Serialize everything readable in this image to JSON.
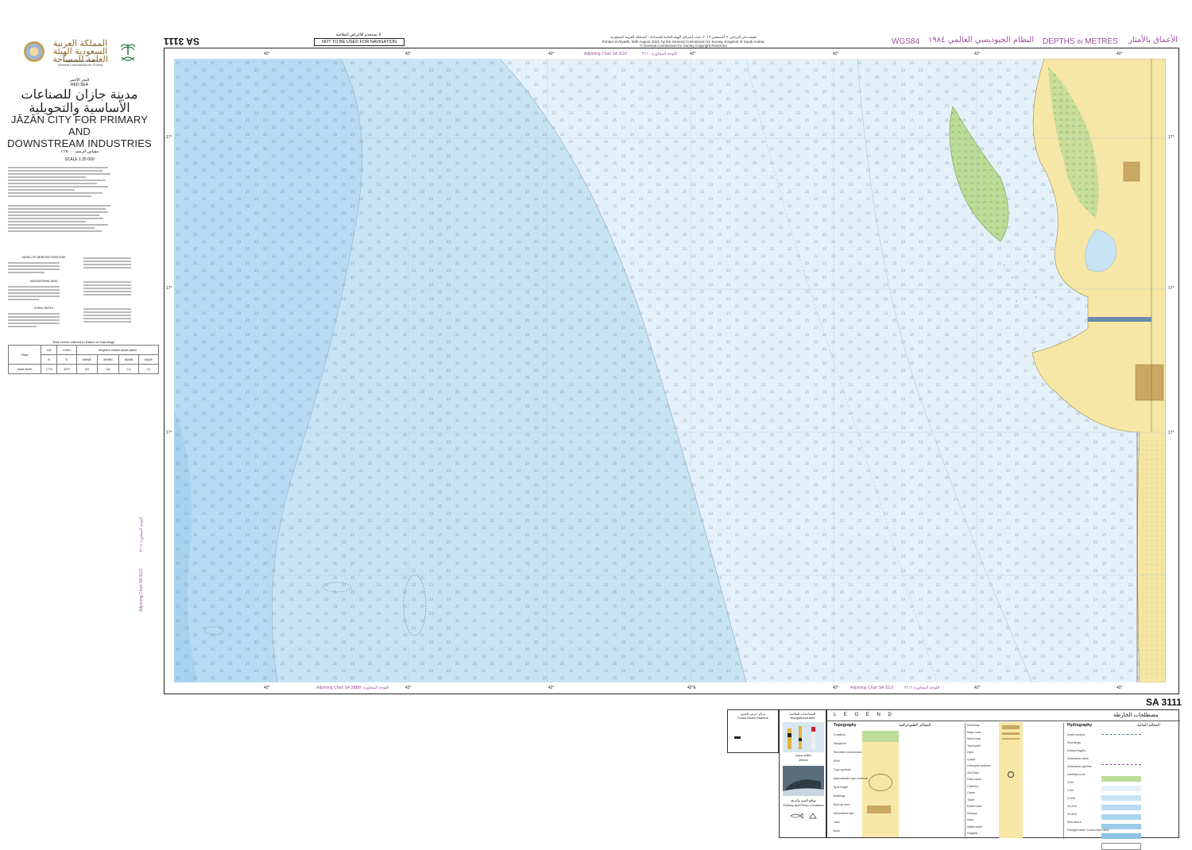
{
  "logo": {
    "arabic_name": "المملكة العربية السعودية الهيئة العامة للمساحة",
    "english_line1": "Kingdom of Saudi Arabia",
    "english_line2": "General Commission for Survey"
  },
  "title": {
    "region_ar": "البحر الأحمر",
    "region_en": "RED SEA",
    "title_ar_line1": "مدينة جازان للصناعات",
    "title_ar_line2": "الأساسية والتحويلية",
    "title_en_line1": "JĀZĀN CITY FOR PRIMARY",
    "title_en_line2": "AND",
    "title_en_line3": "DOWNSTREAM INDUSTRIES",
    "scale_ar": "مقياس الرسم ١:٢٥٠٠٠",
    "scale_en": "SCALE 1:25 000"
  },
  "notes": {
    "satellite_heading": "SATELLITE-DERIVED POSITIONS",
    "navaids_heading": "NAVIGATIONAL AIDS",
    "coral_heading": "CORAL REEFS"
  },
  "tidal": {
    "title": "Tidal Levels referred to Datum of Soundings",
    "col_place": "Place",
    "col_lat": "LAT",
    "col_lat_unit": "N",
    "col_long": "LONG",
    "col_long_unit": "E",
    "col_heights": "Heights in metres above datum",
    "h1": "MHWS",
    "h2": "MHWN",
    "h3": "MLWN",
    "h4": "MLWS",
    "place": "Jazan North",
    "lat": "17°N",
    "long": "42°E",
    "v1": "0,8",
    "v2": "0,6",
    "v3": "0,3",
    "v4": "0,1"
  },
  "header": {
    "chart_number_top": "SA 3111",
    "not_for_nav_ar": "لا تستخدم للأغراض الملاحية",
    "not_for_nav_en": "NOT TO BE USED FOR NAVIGATION",
    "imprint_ar": "طبعت في الرياض، ٩ أغسطس ٢٠١٩، تحت إشراف الهيئة العامة للمساحة - المملكة العربية السعودية",
    "imprint_en_1": "Printed at Riyadh, 09th August 2019, by the General Commission for Survey, Kingdom of Saudi Arabia.",
    "imprint_en_2": "© General Commission for Survey Copyright Reserved",
    "datum": "WGS84",
    "datum_ar": "النظام الجيوديسي العالمي ١٩٨٤",
    "depths": "DEPTHS",
    "depths_in": "IN",
    "depths_metres": "METRES",
    "depths_ar": "الأعماق بالأمتار"
  },
  "adjoining": {
    "top_en": "Adjoining Chart SA 3110",
    "top_ar": "اللوحة المجاورة ٣١١٠",
    "bottom_left_en": "Adjoining Chart SA 3122",
    "bottom_left_ar": "اللوحة المجاورة ٣١٢٢",
    "bottom_right_en": "Adjoining Chart SA 3112",
    "bottom_right_ar": "اللوحة المجاورة ٣١١٢",
    "left_en": "Adjoining Chart SA 3122",
    "left_ar": "اللوحة المجاورة ٣١١١"
  },
  "graticule": {
    "lon_label": "42°",
    "lon_label_e": "42°E",
    "lat_label": "17°"
  },
  "bottom_right_chart_number": "SA 3111",
  "legend": {
    "coast_guard_ar": "مراكز حرس الحدود",
    "coast_guard_en": "Coast Guard Stations",
    "navaids_ar": "المساعدات الملاحية",
    "navaids_en": "Navigational Aids",
    "wreck_ar": "حطام سفينة",
    "wreck_en": "Wreck",
    "fishing_ar": "مواقع الصيد والنزهة",
    "fishing_en": "Fishing and Picnic Locations",
    "legend_word": "L E G E N D",
    "legend_ar": "مصطلحات الخارطة",
    "topography_en": "Topography",
    "topography_ar": "المعالم الطبوغرافية",
    "hydrography_en": "Hydrography",
    "hydrography_ar": "المعالم المائية",
    "topo_items": [
      "Coastline",
      "Mangrove",
      "Shoreline construction",
      "Reef",
      "Tops symbols",
      "Approximate tops contours",
      "Spot height",
      "Buildings",
      "Built-up area",
      "Intermittent lake",
      "Lake",
      "Bush"
    ],
    "road_items": [
      "Motorway",
      "Major road",
      "Minor road",
      "Track/path",
      "Dyke",
      "Quays",
      "Helicopter platform",
      "Silo/Tank",
      "Flare stack",
      "Chimney",
      "Crane",
      "Tower",
      "Radio mast",
      "Mosque",
      "Mast",
      "Water tower",
      "Hospital"
    ],
    "hydro_items": [
      "Depth contour",
      "Soundings",
      "Drying heights",
      "Submarine cable",
      "Submarine pipeline",
      "Intertidal zone",
      "0-2m",
      "2-5m",
      "5-10m",
      "10-20m",
      "20-50m",
      "50m-above",
      "Dredged area / Unsurveyed area"
    ]
  },
  "colors": {
    "deep_water": "#aad4ef",
    "mid_water": "#c7e3f4",
    "shallow_water": "#e4f1fa",
    "land": "#f7e7a6",
    "vegetation": "#bcdc97",
    "magenta": "#9b4f9b"
  }
}
